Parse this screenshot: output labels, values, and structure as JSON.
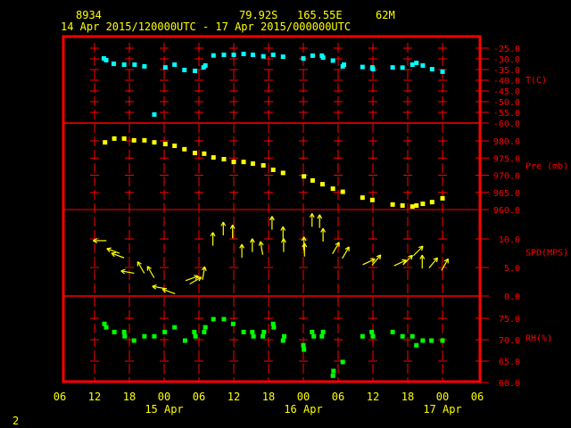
{
  "header": {
    "station_id": "8934",
    "latitude": "79.92S",
    "longitude": "165.55E",
    "elevation": "62M",
    "time_range": "14 Apr 2015/120000UTC - 17 Apr 2015/000000UTC"
  },
  "page_number": "2",
  "colors": {
    "frame": "#ff0000",
    "text": "#ffff00",
    "temperature": "#00ffff",
    "pressure": "#ffff00",
    "wind": "#ffff00",
    "rh": "#00ff00"
  },
  "chart_data": {
    "type": "scatter",
    "x_unit": "hours since 14 Apr 06 UTC",
    "xlim": [
      0,
      72
    ],
    "x_tick_labels": [
      "06",
      "12",
      "18",
      "00",
      "06",
      "12",
      "18",
      "00",
      "06",
      "12",
      "18",
      "00",
      "06"
    ],
    "date_labels": [
      {
        "label": "15 Apr",
        "hour": 18
      },
      {
        "label": "16 Apr",
        "hour": 42
      },
      {
        "label": "17 Apr",
        "hour": 66
      }
    ],
    "panels": [
      {
        "name": "temperature",
        "ylabel": "T(C)",
        "ylim": [
          -60,
          -25
        ],
        "tick_labels": [
          "-25.0",
          "-30.0",
          "-35.0",
          "-40.0",
          "-45.0",
          "-50.0",
          "-55.0",
          "-60.0"
        ],
        "tick_values": [
          -25,
          -30,
          -35,
          -40,
          -45,
          -50,
          -55,
          -60
        ],
        "x": [
          7.6,
          8.0,
          9.3,
          11.1,
          12.9,
          14.6,
          16.3,
          18.2,
          19.8,
          21.5,
          23.3,
          24.8,
          25.1,
          26.5,
          28.3,
          30.0,
          31.7,
          33.3,
          35.1,
          36.8,
          38.5,
          42.0,
          43.6,
          45.2,
          45.4,
          47.1,
          48.8,
          49.0,
          52.2,
          53.9,
          54.0,
          57.4,
          59.1,
          60.8,
          61.5,
          62.6,
          64.2,
          66.0
        ],
        "y": [
          -29.6,
          -30.4,
          -32.1,
          -32.5,
          -32.5,
          -33.3,
          -55.8,
          -33.8,
          -32.5,
          -35.0,
          -35.4,
          -33.8,
          -32.9,
          -28.2,
          -27.9,
          -27.9,
          -27.5,
          -27.9,
          -28.6,
          -27.9,
          -28.8,
          -29.6,
          -28.3,
          -28.3,
          -29.2,
          -30.6,
          -33.3,
          -32.5,
          -33.6,
          -33.8,
          -34.6,
          -33.8,
          -33.9,
          -32.5,
          -31.7,
          -32.9,
          -34.6,
          -35.8
        ]
      },
      {
        "name": "pressure",
        "ylabel": "Pre (mb)",
        "ylim": [
          960,
          980
        ],
        "tick_labels": [
          "980.0",
          "975.0",
          "970.0",
          "965.0",
          "960.0"
        ],
        "tick_values": [
          980,
          975,
          970,
          965,
          960
        ],
        "x": [
          7.8,
          9.4,
          11.1,
          12.8,
          14.6,
          16.3,
          18.2,
          19.8,
          21.5,
          23.3,
          24.9,
          26.5,
          28.3,
          30.0,
          31.7,
          33.3,
          35.1,
          36.8,
          38.5,
          42.1,
          43.6,
          45.3,
          47.1,
          48.8,
          52.2,
          53.9,
          57.4,
          59.1,
          60.8,
          61.5,
          62.6,
          64.2,
          66.0
        ],
        "y": [
          979.7,
          980.8,
          980.8,
          980.3,
          980.3,
          979.7,
          979.2,
          978.7,
          977.7,
          976.6,
          976.4,
          975.3,
          974.8,
          974.0,
          974.0,
          973.5,
          973.0,
          971.7,
          970.8,
          969.8,
          968.6,
          967.5,
          966.2,
          965.3,
          963.6,
          962.9,
          961.6,
          961.3,
          961.0,
          961.3,
          961.8,
          962.3,
          963.4
        ]
      },
      {
        "name": "wind",
        "ylabel": "SPD(MPS)",
        "ylim": [
          0,
          10
        ],
        "tick_labels": [
          "10.0",
          "5.0",
          "0.0"
        ],
        "tick_values": [
          10,
          5,
          0
        ],
        "x": [
          6.9,
          9.2,
          10.0,
          11.7,
          14.0,
          15.7,
          17.1,
          18.8,
          22.8,
          23.4,
          24.8,
          26.4,
          28.2,
          29.8,
          31.4,
          33.2,
          34.8,
          36.6,
          38.5,
          38.6,
          42.1,
          42.2,
          43.5,
          44.8,
          45.4,
          47.6,
          49.3,
          53.3,
          54.6,
          58.7,
          60.0,
          61.8,
          62.5,
          64.4,
          66.4
        ],
        "y": [
          9.7,
          7.9,
          7.1,
          4.2,
          5.0,
          4.2,
          1.5,
          0.8,
          3.1,
          2.7,
          4.0,
          10.0,
          11.8,
          11.3,
          7.9,
          8.9,
          8.4,
          12.8,
          11.0,
          8.9,
          9.2,
          8.1,
          13.3,
          13.1,
          10.7,
          8.4,
          7.6,
          6.0,
          6.3,
          5.8,
          6.3,
          7.9,
          6.0,
          5.8,
          5.5
        ],
        "direction_to_deg": [
          270,
          290,
          290,
          280,
          330,
          330,
          280,
          290,
          70,
          60,
          10,
          0,
          0,
          0,
          0,
          0,
          350,
          0,
          0,
          0,
          0,
          0,
          0,
          0,
          0,
          30,
          30,
          65,
          40,
          65,
          45,
          45,
          0,
          40,
          30
        ]
      },
      {
        "name": "rh",
        "ylabel": "RH(%)",
        "ylim": [
          60,
          75
        ],
        "tick_labels": [
          "75.0",
          "70.0",
          "65.0",
          "60.0"
        ],
        "tick_values": [
          75,
          70,
          65,
          60
        ],
        "x": [
          7.7,
          8.0,
          9.4,
          11.1,
          11.2,
          12.8,
          14.6,
          16.3,
          18.1,
          19.8,
          21.6,
          23.2,
          23.4,
          24.9,
          25.1,
          26.5,
          28.3,
          29.9,
          31.7,
          33.2,
          33.4,
          35.0,
          35.2,
          36.8,
          36.9,
          38.5,
          38.7,
          42.0,
          42.1,
          43.5,
          43.8,
          45.2,
          45.4,
          47.1,
          47.2,
          48.8,
          52.2,
          53.8,
          54.0,
          57.4,
          59.1,
          60.8,
          61.5,
          62.6,
          64.1,
          66.0
        ],
        "y": [
          73.8,
          73.0,
          71.9,
          71.9,
          70.9,
          69.9,
          70.9,
          70.9,
          71.9,
          73.0,
          69.9,
          71.9,
          70.9,
          71.9,
          73.0,
          74.9,
          74.9,
          73.8,
          71.9,
          71.9,
          70.9,
          70.9,
          71.9,
          73.8,
          73.0,
          69.9,
          70.9,
          68.8,
          67.8,
          71.9,
          70.9,
          70.9,
          71.9,
          61.7,
          62.8,
          64.9,
          70.9,
          71.9,
          70.9,
          71.9,
          70.9,
          70.9,
          68.8,
          69.9,
          69.9,
          69.9
        ]
      }
    ]
  }
}
